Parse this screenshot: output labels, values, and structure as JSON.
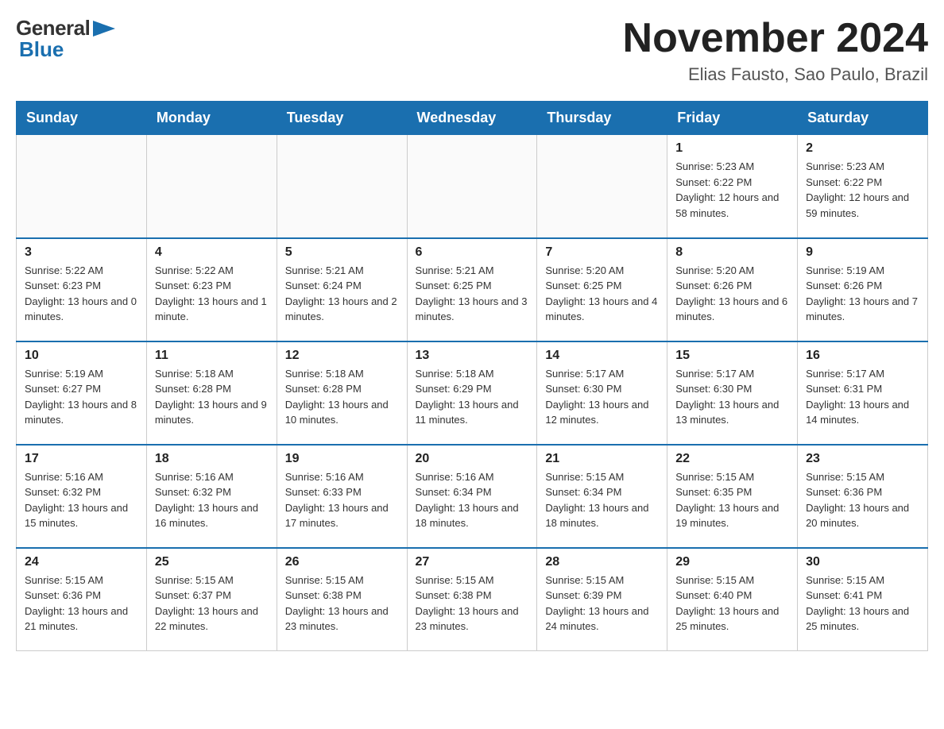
{
  "header": {
    "logo_general": "General",
    "logo_blue": "Blue",
    "title": "November 2024",
    "subtitle": "Elias Fausto, Sao Paulo, Brazil"
  },
  "weekdays": [
    "Sunday",
    "Monday",
    "Tuesday",
    "Wednesday",
    "Thursday",
    "Friday",
    "Saturday"
  ],
  "weeks": [
    [
      {
        "day": "",
        "info": ""
      },
      {
        "day": "",
        "info": ""
      },
      {
        "day": "",
        "info": ""
      },
      {
        "day": "",
        "info": ""
      },
      {
        "day": "",
        "info": ""
      },
      {
        "day": "1",
        "info": "Sunrise: 5:23 AM\nSunset: 6:22 PM\nDaylight: 12 hours and 58 minutes."
      },
      {
        "day": "2",
        "info": "Sunrise: 5:23 AM\nSunset: 6:22 PM\nDaylight: 12 hours and 59 minutes."
      }
    ],
    [
      {
        "day": "3",
        "info": "Sunrise: 5:22 AM\nSunset: 6:23 PM\nDaylight: 13 hours and 0 minutes."
      },
      {
        "day": "4",
        "info": "Sunrise: 5:22 AM\nSunset: 6:23 PM\nDaylight: 13 hours and 1 minute."
      },
      {
        "day": "5",
        "info": "Sunrise: 5:21 AM\nSunset: 6:24 PM\nDaylight: 13 hours and 2 minutes."
      },
      {
        "day": "6",
        "info": "Sunrise: 5:21 AM\nSunset: 6:25 PM\nDaylight: 13 hours and 3 minutes."
      },
      {
        "day": "7",
        "info": "Sunrise: 5:20 AM\nSunset: 6:25 PM\nDaylight: 13 hours and 4 minutes."
      },
      {
        "day": "8",
        "info": "Sunrise: 5:20 AM\nSunset: 6:26 PM\nDaylight: 13 hours and 6 minutes."
      },
      {
        "day": "9",
        "info": "Sunrise: 5:19 AM\nSunset: 6:26 PM\nDaylight: 13 hours and 7 minutes."
      }
    ],
    [
      {
        "day": "10",
        "info": "Sunrise: 5:19 AM\nSunset: 6:27 PM\nDaylight: 13 hours and 8 minutes."
      },
      {
        "day": "11",
        "info": "Sunrise: 5:18 AM\nSunset: 6:28 PM\nDaylight: 13 hours and 9 minutes."
      },
      {
        "day": "12",
        "info": "Sunrise: 5:18 AM\nSunset: 6:28 PM\nDaylight: 13 hours and 10 minutes."
      },
      {
        "day": "13",
        "info": "Sunrise: 5:18 AM\nSunset: 6:29 PM\nDaylight: 13 hours and 11 minutes."
      },
      {
        "day": "14",
        "info": "Sunrise: 5:17 AM\nSunset: 6:30 PM\nDaylight: 13 hours and 12 minutes."
      },
      {
        "day": "15",
        "info": "Sunrise: 5:17 AM\nSunset: 6:30 PM\nDaylight: 13 hours and 13 minutes."
      },
      {
        "day": "16",
        "info": "Sunrise: 5:17 AM\nSunset: 6:31 PM\nDaylight: 13 hours and 14 minutes."
      }
    ],
    [
      {
        "day": "17",
        "info": "Sunrise: 5:16 AM\nSunset: 6:32 PM\nDaylight: 13 hours and 15 minutes."
      },
      {
        "day": "18",
        "info": "Sunrise: 5:16 AM\nSunset: 6:32 PM\nDaylight: 13 hours and 16 minutes."
      },
      {
        "day": "19",
        "info": "Sunrise: 5:16 AM\nSunset: 6:33 PM\nDaylight: 13 hours and 17 minutes."
      },
      {
        "day": "20",
        "info": "Sunrise: 5:16 AM\nSunset: 6:34 PM\nDaylight: 13 hours and 18 minutes."
      },
      {
        "day": "21",
        "info": "Sunrise: 5:15 AM\nSunset: 6:34 PM\nDaylight: 13 hours and 18 minutes."
      },
      {
        "day": "22",
        "info": "Sunrise: 5:15 AM\nSunset: 6:35 PM\nDaylight: 13 hours and 19 minutes."
      },
      {
        "day": "23",
        "info": "Sunrise: 5:15 AM\nSunset: 6:36 PM\nDaylight: 13 hours and 20 minutes."
      }
    ],
    [
      {
        "day": "24",
        "info": "Sunrise: 5:15 AM\nSunset: 6:36 PM\nDaylight: 13 hours and 21 minutes."
      },
      {
        "day": "25",
        "info": "Sunrise: 5:15 AM\nSunset: 6:37 PM\nDaylight: 13 hours and 22 minutes."
      },
      {
        "day": "26",
        "info": "Sunrise: 5:15 AM\nSunset: 6:38 PM\nDaylight: 13 hours and 23 minutes."
      },
      {
        "day": "27",
        "info": "Sunrise: 5:15 AM\nSunset: 6:38 PM\nDaylight: 13 hours and 23 minutes."
      },
      {
        "day": "28",
        "info": "Sunrise: 5:15 AM\nSunset: 6:39 PM\nDaylight: 13 hours and 24 minutes."
      },
      {
        "day": "29",
        "info": "Sunrise: 5:15 AM\nSunset: 6:40 PM\nDaylight: 13 hours and 25 minutes."
      },
      {
        "day": "30",
        "info": "Sunrise: 5:15 AM\nSunset: 6:41 PM\nDaylight: 13 hours and 25 minutes."
      }
    ]
  ]
}
